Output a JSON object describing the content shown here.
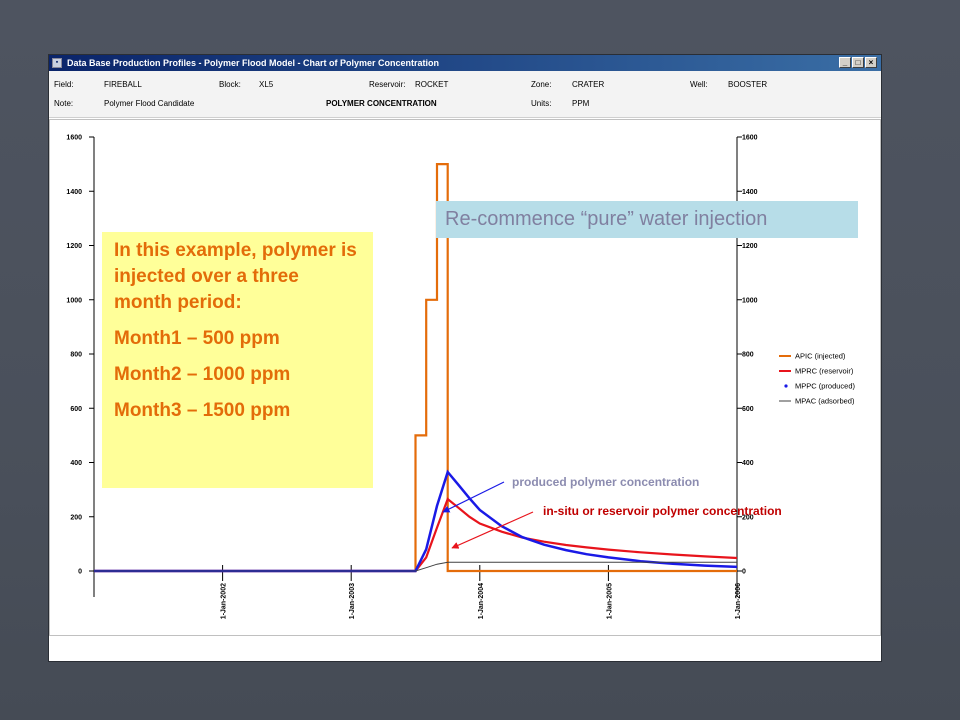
{
  "window": {
    "title": "Data Base Production Profiles - Polymer Flood Model - Chart of Polymer Concentration",
    "buttons": {
      "minimize": "_",
      "maximize": "□",
      "close": "×"
    }
  },
  "info": {
    "field_label": "Field:",
    "field_value": "FIREBALL",
    "block_label": "Block:",
    "block_value": "XL5",
    "reservoir_label": "Reservoir:",
    "reservoir_value": "ROCKET",
    "zone_label": "Zone:",
    "zone_value": "CRATER",
    "well_label": "Well:",
    "well_value": "BOOSTER",
    "note_label": "Note:",
    "note_value": "Polymer Flood Candidate",
    "heading": "POLYMER CONCENTRATION",
    "units_label": "Units:",
    "units_value": "PPM"
  },
  "overlay": {
    "note_intro": "In this example, polymer is injected over a three month period:",
    "month1": "Month1 – 500 ppm",
    "month2": "Month2 – 1000 ppm",
    "month3": "Month3 – 1500 ppm",
    "recommence": "Re-commence “pure” water injection",
    "produced_label": "produced polymer concentration",
    "insitu_label": "in-situ or reservoir polymer concentration"
  },
  "colors": {
    "injected": "#e46c0a",
    "reservoir": "#e8141c",
    "produced": "#1a1ae6",
    "adsorbed": "#404040",
    "note_bg": "#ffff99",
    "note_text": "#e36c09",
    "produced_label": "#8c8cb0",
    "insitu_label": "#c00000"
  },
  "chart_data": {
    "type": "line",
    "ylim": [
      0,
      1600
    ],
    "xlim": [
      2001.0,
      2006.0
    ],
    "yticks": [
      0,
      200,
      400,
      600,
      800,
      1000,
      1200,
      1400,
      1600
    ],
    "ytick_labels": [
      "0",
      "200",
      "400",
      "600",
      "800",
      "1000",
      "1200",
      "1400",
      "1600"
    ],
    "xticks": [
      2002,
      2003,
      2004,
      2005,
      2006
    ],
    "xtick_labels": [
      "1-Jan-2002",
      "1-Jan-2003",
      "1-Jan-2004",
      "1-Jan-2005",
      "1-Jan-2006"
    ],
    "legend_position": "right",
    "series": [
      {
        "name": "APIC (injected)",
        "style": "step",
        "points": [
          [
            2001.0,
            0
          ],
          [
            2003.5,
            0
          ],
          [
            2003.5,
            500
          ],
          [
            2003.583,
            500
          ],
          [
            2003.583,
            1000
          ],
          [
            2003.667,
            1000
          ],
          [
            2003.667,
            1500
          ],
          [
            2003.75,
            1500
          ],
          [
            2003.75,
            0
          ],
          [
            2006.0,
            0
          ]
        ]
      },
      {
        "name": "MPRC (reservoir)",
        "style": "line",
        "points": [
          [
            2001.0,
            0
          ],
          [
            2003.5,
            0
          ],
          [
            2003.583,
            50
          ],
          [
            2003.667,
            160
          ],
          [
            2003.75,
            265
          ],
          [
            2003.83,
            235
          ],
          [
            2003.92,
            200
          ],
          [
            2004.0,
            175
          ],
          [
            2004.17,
            145
          ],
          [
            2004.33,
            123
          ],
          [
            2004.5,
            108
          ],
          [
            2004.67,
            96
          ],
          [
            2004.83,
            87
          ],
          [
            2005.0,
            79
          ],
          [
            2005.25,
            69
          ],
          [
            2005.5,
            61
          ],
          [
            2005.75,
            54
          ],
          [
            2006.0,
            48
          ]
        ]
      },
      {
        "name": "MPPC (produced)",
        "style": "line",
        "points": [
          [
            2001.0,
            0
          ],
          [
            2003.5,
            0
          ],
          [
            2003.583,
            80
          ],
          [
            2003.667,
            240
          ],
          [
            2003.75,
            365
          ],
          [
            2003.83,
            320
          ],
          [
            2003.92,
            268
          ],
          [
            2004.0,
            225
          ],
          [
            2004.17,
            165
          ],
          [
            2004.33,
            125
          ],
          [
            2004.5,
            97
          ],
          [
            2004.67,
            77
          ],
          [
            2004.83,
            62
          ],
          [
            2005.0,
            50
          ],
          [
            2005.25,
            36
          ],
          [
            2005.5,
            27
          ],
          [
            2005.75,
            20
          ],
          [
            2006.0,
            15
          ]
        ]
      },
      {
        "name": "MPAC (adsorbed)",
        "style": "line",
        "points": [
          [
            2001.0,
            0
          ],
          [
            2003.5,
            0
          ],
          [
            2003.583,
            12
          ],
          [
            2003.667,
            25
          ],
          [
            2003.75,
            32
          ],
          [
            2004.0,
            32
          ],
          [
            2006.0,
            32
          ]
        ]
      }
    ]
  }
}
